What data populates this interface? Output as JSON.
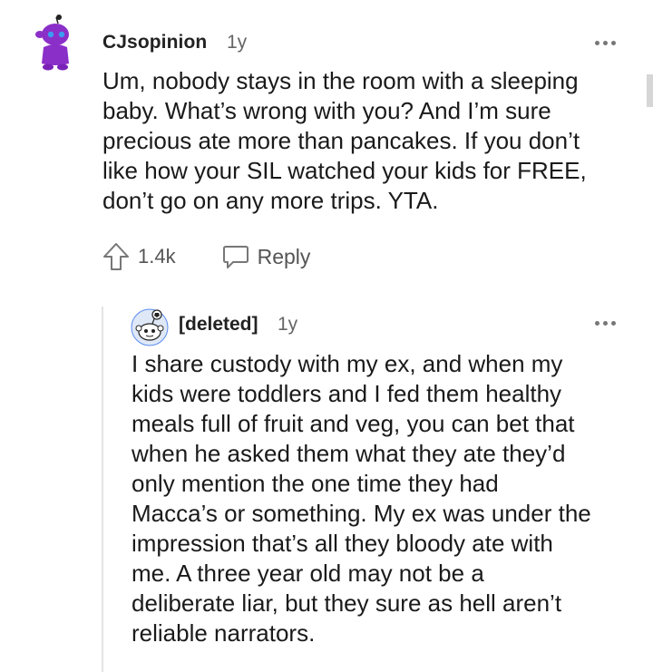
{
  "comments": [
    {
      "author": "CJsopinion",
      "age": "1y",
      "body_lines": [
        "Um, nobody stays in the room with a sleeping",
        "baby. What’s wrong with you? And I’m sure",
        "precious ate more than pancakes. If you don’t",
        "like how your SIL watched your kids for FREE,",
        "don’t go on any more trips. YTA."
      ],
      "upvotes": "1.4k",
      "reply_label": "Reply",
      "avatar_icon": "snoo-avatar-purple-icon",
      "accent_color": "#8b2fc9"
    },
    {
      "author": "[deleted]",
      "age": "1y",
      "body_lines": [
        "I share custody with my ex, and when my",
        "kids were toddlers and I fed them healthy",
        "meals full of fruit and veg, you can bet that",
        "when he asked them what they ate they’d",
        "only mention the one time they had",
        "Macca’s or something. My ex was under the",
        "impression that’s all they bloody ate with",
        "me. A three year old may not be a",
        "deliberate liar, but they sure as hell aren’t",
        "reliable narrators."
      ],
      "avatar_icon": "snoo-avatar-default-icon",
      "accent_color": "#5a8cf0"
    }
  ]
}
